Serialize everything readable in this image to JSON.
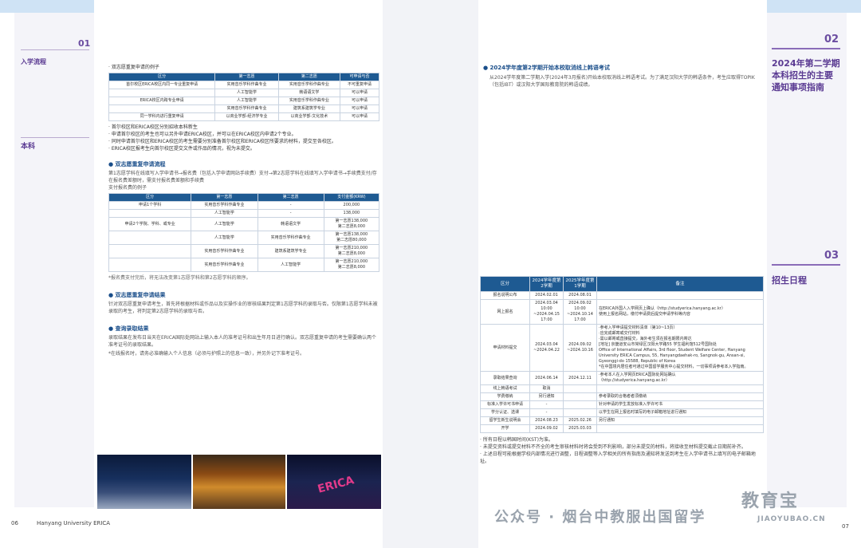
{
  "left": {
    "sec01_num": "01",
    "nav1": "入学流程",
    "nav2": "本科",
    "dual_example_heading": "· 双志愿重复申请的例子",
    "dual_table": {
      "headers": [
        "区分",
        "第一志愿",
        "第二志愿",
        "可申请与否"
      ],
      "rows": [
        [
          "首尔校区ERICA校区内同一专业重复申请",
          "实用音乐学科作曲专业",
          "实用音乐学科作曲专业",
          "不可重复申请"
        ],
        [
          "",
          "人工智能学",
          "韩语语文学",
          "可以申请"
        ],
        [
          "ERICA校区内跨专业申请",
          "人工智能学",
          "实用音乐学科作曲专业",
          "可以申请"
        ],
        [
          "",
          "实用音乐学科作曲专业",
          "建筑系建筑学专业",
          "可以申请"
        ],
        [
          "同一学科内进行重复申请",
          "以商业学部-经济学专业",
          "以商业学部-文化技术",
          "可以申请"
        ]
      ]
    },
    "bullets1": [
      "· 首尔校区和ERICA校区分别招收本科新生",
      "· 申请首尔校区的考生也可以另外申请ERICA校区，并可以在ERICA校区内申请2个专业。",
      "· 同时申请首尔校区和ERICA校区的考生需要分别准备首尔校区和ERICA校区所要求的材料，提交至各校区。",
      "· ERICA校区报考生向首尔校区提交文件或作品的情况，视为未提交。"
    ],
    "flow_heading": "● 双志愿重复申请流程",
    "flow_text": "第1志愿学科在线填写入学申请书→报名费（包括入学申请网站手续费）支付→第2志愿学科在线填写入学申请书→手续费支付/存在报名费差额时，需支付报名费差额和手续费",
    "fee_example_heading": "支付报名费的例子",
    "fee_table": {
      "headers": [
        "区分",
        "第一志愿",
        "第二志愿",
        "支付金额(KRW)"
      ],
      "rows": [
        [
          "申请1个学科",
          "实用音乐学科作曲专业",
          "-",
          "200,000"
        ],
        [
          "",
          "人工智能学",
          "-",
          "138,000"
        ],
        [
          "申请2个学院、学科、或专业",
          "人工智能学",
          "韩语语文学",
          "第一志愿138,000\n第二志愿8,000"
        ],
        [
          "",
          "人工智能学",
          "实用音乐学科作曲专业",
          "第一志愿138,000\n第二志愿80,000"
        ],
        [
          "",
          "实用音乐学科作曲专业",
          "建筑系建筑学专业",
          "第一志愿210,000\n第二志愿8,000"
        ],
        [
          "",
          "实用音乐学科作曲专业",
          "人工智能学",
          "第一志愿210,000\n第二志愿8,000"
        ]
      ]
    },
    "fee_note": "*报名费支付完后，将无法改变第1志愿学科和第2志愿学科的顺序。",
    "result_heading": "● 双志愿重复申请结果",
    "result_text": "针对双志愿重复申请考生，首先将根据材料或作品以及实操作业的审核结果判定第1志愿学科的录取与否。仅限第1志愿学科未被录取的考生，将判定第2志愿学科的录取与否。",
    "query_heading": "● 查询录取结果",
    "query_text": "录取结果在发布日当天在ERICA国际处网站上输入本人的准考证号和出生年月日进行确认。双志愿重复申请的考生需要确认两个准考证号的录取结果。",
    "query_note": "*在线报名时，请务必准确输入个人信息（必须与护照上的信息一致），并另外记下准考证号。",
    "footer_page": "06",
    "footer_name": "Hanyang University ERICA"
  },
  "right": {
    "sec02_num": "02",
    "sec02_title": "2024年第二学期本科招生的主要通知事项指南",
    "sec03_num": "03",
    "sec03_title": "招生日程",
    "notice_heading": "● 2024学年度第2学期开始本校取消线上韩语考试",
    "notice_text": "从2024学年度第二学期入学(2024年3月报名)开始本校取消线上韩语考试。为了满足汉阳大学的韩语条件，考生应取得TOPIK（包括IBT）或汉阳大学国际教育院的韩语成绩。",
    "schedule": {
      "headers": [
        "区分",
        "2024学年度第2学期",
        "2025学年度第1学期",
        "备注"
      ],
      "rows": [
        [
          "报名说明公布",
          "2024.02.01",
          "2024.08.01",
          ""
        ],
        [
          "网上报名",
          "2024.03.04 10:00 ~2024.04.15 17:00",
          "2024.09.02 10:00 ~2024.10.14 17:00",
          "在ERICA外国人入学网页上确认（http://studyerica.hanyang.ac.kr）\n使用上报名网站，缴付申请费后提交申请学科等内容"
        ],
        [
          "申请材料提交",
          "2024.03.04 ~2024.04.22",
          "2024.09.02 ~2024.10.16",
          "·参考入学申请提交材料清单（第10~13页）\n·应完成邮寄或交付材料\n·需以邮寄或直接提交，海外考生须在报名期限内寄达\n[地址] 京畿道安山市常绿区汉阳大学路55 学生福利馆512号国际处\nOffice of International Affairs, 3rd floor, Student Welfare Center, Hanyang University ERICA Campus, 55, Hanyangdaehak-ro, Sangnok-gu, Ansan-si, Gyeonggi-do 15588, Republic of Korea\n*在中国境内居住者可通过中国留学服务中心提交材料，一切事项请参考本入学指南。"
        ],
        [
          "录取结果查询",
          "2024.06.14",
          "2024.12.11",
          "·参考本人在入学网页ERICA国际处网站确认\n（http://studyerica.hanyang.ac.kr）"
        ],
        [
          "线上韩语考试",
          "取消",
          "",
          ""
        ],
        [
          "学费缴纳",
          "另行通知",
          "",
          "参考录取的合格者者须缴纳"
        ],
        [
          "标准入学许可书申请",
          "-",
          "",
          "针对申请的学生发放标准入学许可书"
        ],
        [
          "学分认证、选课",
          "-",
          "",
          "以学生在网上报名时填写的电子邮箱地址进行通知"
        ],
        [
          "留学生新生说明会",
          "2024.08.23",
          "2025.02.26",
          "另行通知"
        ],
        [
          "开学",
          "2024.09.02",
          "2025.03.03",
          ""
        ]
      ]
    },
    "notes": [
      "· 所有日程以韩国时间(KST)为准。",
      "· 未提交资料或提交材料不齐全的考生审核材料时将会受到不利影响，部分未提交的材料，将接收至材料提交截止日期前补齐。",
      "· 上述日程可能根据学校内部情况进行调整，日程调整等入学相关的所有指南及通知将发送到考生在入学申请书上填写的电子邮箱地址。"
    ],
    "footer_page": "07",
    "watermark1": "公众号 · 烟台中教服出国留学",
    "watermark2": "教育宝",
    "watermark3": "JIAOYUBAO.CN"
  }
}
